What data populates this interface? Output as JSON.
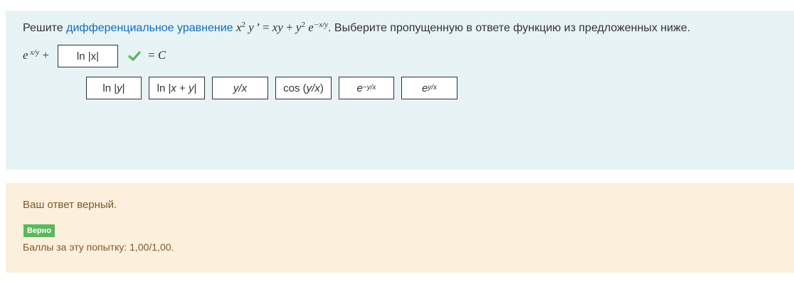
{
  "question": {
    "prefix": "Решите ",
    "link_text": "дифференциальное уравнение",
    "suffix": ". Выберите пропущенную в ответе функцию из предложенных ниже."
  },
  "answer": {
    "dropped_value": "ln |x|",
    "status_icon": "check-icon"
  },
  "choices": [
    "ln |y|",
    "ln |x + y|",
    "y/x",
    "cos (y/x)",
    "e^{-y/x}",
    "e^{y/x}"
  ],
  "feedback": {
    "message": "Ваш ответ верный.",
    "badge": "Верно",
    "score": "Баллы за эту попытку: 1,00/1,00."
  },
  "colors": {
    "question_bg": "#e7f3f5",
    "feedback_bg": "#fcefdc",
    "link": "#0f6cbf",
    "correct": "#5cb85c",
    "feedback_text": "#7d5a29"
  }
}
